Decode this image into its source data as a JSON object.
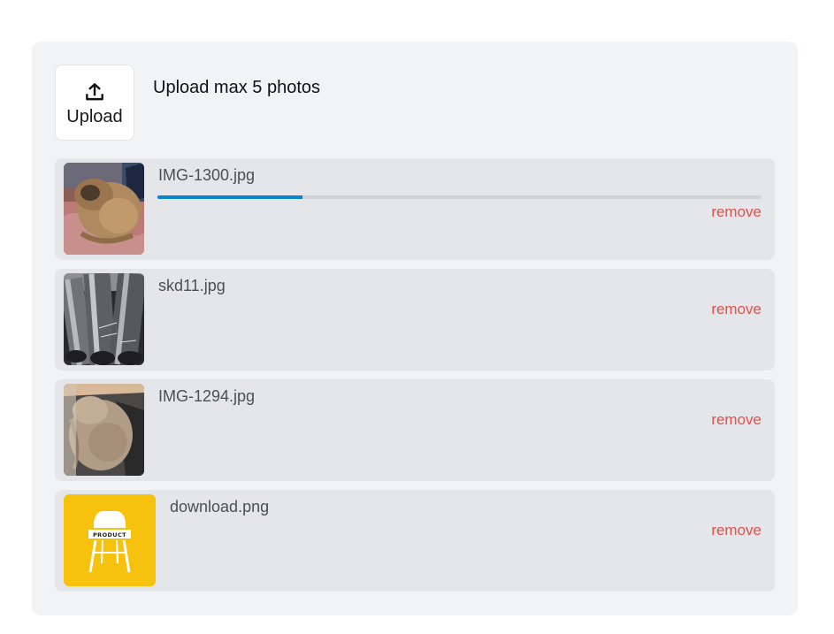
{
  "uploader": {
    "button_label": "Upload",
    "hint": "Upload max 5 photos",
    "icon": "upload-icon"
  },
  "files": [
    {
      "name": "IMG-1300.jpg",
      "remove_label": "remove",
      "progress": 0.24,
      "thumbnail": "pug-on-blanket"
    },
    {
      "name": "skd11.jpg",
      "remove_label": "remove",
      "thumbnail": "steel-rods"
    },
    {
      "name": "IMG-1294.jpg",
      "remove_label": "remove",
      "thumbnail": "dog-on-couch"
    },
    {
      "name": "download.png",
      "remove_label": "remove",
      "thumbnail": "product-chair-logo",
      "thumbnail_text": "PRODUCT"
    }
  ],
  "colors": {
    "panel_bg": "#f2f3f5",
    "item_bg": "#e5e6e9",
    "progress": "#0a84d0",
    "remove": "#e2504a",
    "product_yellow": "#f7c20e"
  }
}
